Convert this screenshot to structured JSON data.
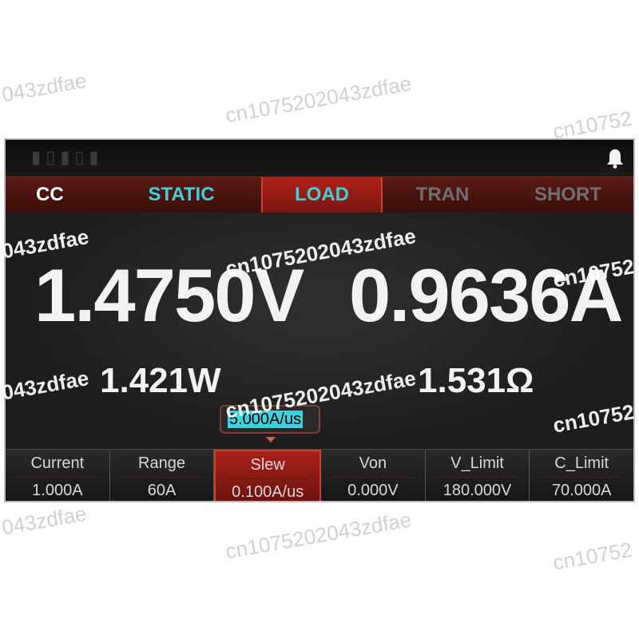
{
  "tabs": [
    {
      "label": "CC"
    },
    {
      "label": "STATIC"
    },
    {
      "label": "LOAD"
    },
    {
      "label": "TRAN"
    },
    {
      "label": "SHORT"
    }
  ],
  "readings": {
    "voltage": "1.4750V",
    "current": "0.9636A",
    "power": "1.421W",
    "resistance": "1.531Ω"
  },
  "edit_value": "5.000A/us",
  "params": [
    {
      "label": "Current",
      "value": "1.000A"
    },
    {
      "label": "Range",
      "value": "60A"
    },
    {
      "label": "Slew",
      "value": "0.100A/us"
    },
    {
      "label": "Von",
      "value": "0.000V"
    },
    {
      "label": "V_Limit",
      "value": "180.000V"
    },
    {
      "label": "C_Limit",
      "value": "70.000A"
    }
  ],
  "watermarks": {
    "w1": "043zdfae",
    "w2": "cn1075202043zdfae",
    "w3": "cn10752",
    "w4": "043zdfae",
    "w5": "cn1075202043zdfae",
    "w6": "cn10752",
    "w7": "043zdfae",
    "w8": "cn1075202043zdfae",
    "w9": "cn10752",
    "w10": "043zdfae",
    "w11": "cn1075202043zdfae",
    "w12": "cn10752"
  },
  "colors": {
    "accent_cyan": "#3fd0dc",
    "active_red": "#a8221a",
    "tab_inactive": "#6e6e6e"
  }
}
